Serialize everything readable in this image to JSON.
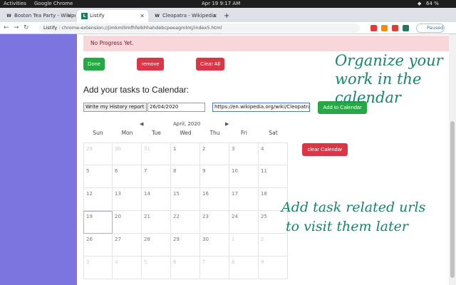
{
  "topbar": {
    "activities": "Activities",
    "app": "Google Chrome",
    "clock": "Apr 19  9:17 AM",
    "battery": "64 %"
  },
  "tabs": [
    {
      "label": "Boston Tea Party - Wikipe",
      "favicon": "W",
      "close": "✕"
    },
    {
      "label": "Listify",
      "favicon": "L",
      "close": "✕"
    },
    {
      "label": "Cleopatra - Wikipedia",
      "favicon": "W",
      "close": "✕"
    }
  ],
  "newtab": "+",
  "address": {
    "site": "Listify",
    "url": "chrome-extension://jimkmllimfhfelkhhahdebcpeeagmlmj/index5.html",
    "paused": "Paused"
  },
  "alert": "No Progress Yet.",
  "buttons": {
    "done": "Done",
    "remove": "remove",
    "clear_all": "Clear All",
    "add_calendar": "Add to Calendar",
    "clear_calendar": "clear Calendar"
  },
  "calendar_title": "Add your tasks to Calendar:",
  "form": {
    "task": "Write my History report",
    "date": "26/04/2020",
    "url": "https://en.wikipedia.org/wiki/Cleopatra"
  },
  "calendar": {
    "month": "April, 2020",
    "prev": "◀",
    "next": "▶",
    "days": [
      "Sun",
      "Mon",
      "Tue",
      "Wed",
      "Thu",
      "Fri",
      "Sat"
    ],
    "weeks": [
      [
        "29",
        "30",
        "31",
        "1",
        "2",
        "3",
        "4"
      ],
      [
        "5",
        "6",
        "7",
        "8",
        "9",
        "10",
        "11"
      ],
      [
        "12",
        "13",
        "14",
        "15",
        "16",
        "17",
        "18"
      ],
      [
        "19",
        "20",
        "21",
        "22",
        "23",
        "24",
        "25"
      ],
      [
        "26",
        "27",
        "28",
        "29",
        "30",
        "1",
        "2"
      ],
      [
        "3",
        "4",
        "5",
        "6",
        "7",
        "8",
        "9"
      ]
    ]
  },
  "promo": {
    "line1": "Organize your",
    "line2": "work in the",
    "line3": "calendar",
    "line4": "Add task related urls",
    "line5": "to visit them later"
  },
  "colors": {
    "accent_purple": "#7c75df",
    "success": "#28a745",
    "danger": "#dc3545",
    "script_green": "#14876a"
  }
}
